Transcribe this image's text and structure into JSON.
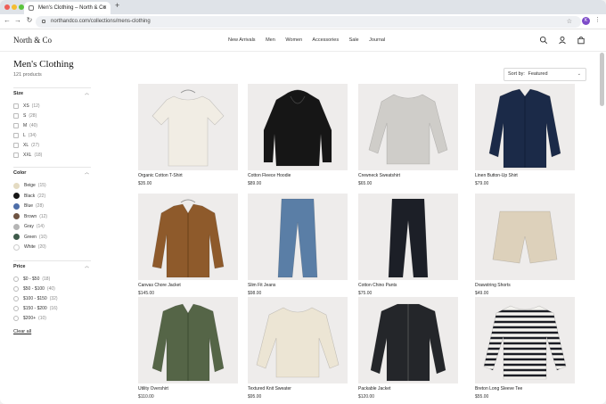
{
  "browser": {
    "tab_title": "Men's Clothing – North & Co",
    "url": "northandco.com/collections/mens-clothing",
    "profile_initial": "K"
  },
  "site": {
    "logo": "North & Co",
    "nav": [
      "New Arrivals",
      "Men",
      "Women",
      "Accessories",
      "Sale",
      "Journal"
    ]
  },
  "page": {
    "title": "Men's Clothing",
    "count": "121 products",
    "sort_label": "Sort by:",
    "sort_value": "Featured"
  },
  "filters": {
    "size": {
      "title": "Size",
      "options": [
        {
          "label": "XS",
          "count": "(12)"
        },
        {
          "label": "S",
          "count": "(28)"
        },
        {
          "label": "M",
          "count": "(40)"
        },
        {
          "label": "L",
          "count": "(34)"
        },
        {
          "label": "XL",
          "count": "(27)"
        },
        {
          "label": "XXL",
          "count": "(18)"
        }
      ]
    },
    "color": {
      "title": "Color",
      "options": [
        {
          "label": "Beige",
          "count": "(15)",
          "hex": "#e4dbc2"
        },
        {
          "label": "Black",
          "count": "(22)",
          "hex": "#161616"
        },
        {
          "label": "Blue",
          "count": "(28)",
          "hex": "#4e6ea8"
        },
        {
          "label": "Brown",
          "count": "(12)",
          "hex": "#6f5443"
        },
        {
          "label": "Gray",
          "count": "(14)",
          "hex": "#b5b5b5"
        },
        {
          "label": "Green",
          "count": "(10)",
          "hex": "#3e5a4a"
        },
        {
          "label": "White",
          "count": "(20)",
          "hex": "#ffffff"
        }
      ]
    },
    "price": {
      "title": "Price",
      "options": [
        {
          "label": "$0 - $50",
          "count": "(18)"
        },
        {
          "label": "$50 - $100",
          "count": "(40)"
        },
        {
          "label": "$100 - $150",
          "count": "(32)"
        },
        {
          "label": "$150 - $200",
          "count": "(16)"
        },
        {
          "label": "$200+",
          "count": "(10)"
        }
      ]
    },
    "clear_all": "Clear all"
  },
  "products": [
    {
      "name": "Organic Cotton T-Shirt",
      "price": "$35.00",
      "icon": "tshirt-image",
      "color": "#f1ede4"
    },
    {
      "name": "Cotton Fleece Hoodie",
      "price": "$89.00",
      "icon": "hoodie-image",
      "color": "#161616"
    },
    {
      "name": "Crewneck Sweatshirt",
      "price": "$65.00",
      "icon": "sweatshirt-image",
      "color": "#cfcdc9"
    },
    {
      "name": "Linen Button-Up Shirt",
      "price": "$79.00",
      "icon": "shirt-image",
      "color": "#1b2a48"
    },
    {
      "name": "Canvas Chore Jacket",
      "price": "$145.00",
      "icon": "jacket-image",
      "color": "#8e5a2b"
    },
    {
      "name": "Slim Fit Jeans",
      "price": "$98.00",
      "icon": "jeans-image",
      "color": "#5a7ea6"
    },
    {
      "name": "Cotton Chino Pants",
      "price": "$75.00",
      "icon": "pants-image",
      "color": "#1c1f27"
    },
    {
      "name": "Drawstring Shorts",
      "price": "$49.00",
      "icon": "shorts-image",
      "color": "#ddd1bb"
    },
    {
      "name": "Utility Overshirt",
      "price": "$110.00",
      "icon": "overshirt-image",
      "color": "#556547"
    },
    {
      "name": "Textured Knit Sweater",
      "price": "$95.00",
      "icon": "sweater-image",
      "color": "#ece5d4"
    },
    {
      "name": "Packable Jacket",
      "price": "$120.00",
      "icon": "packable-jacket-image",
      "color": "#24262a"
    },
    {
      "name": "Breton Long Sleeve Tee",
      "price": "$55.00",
      "icon": "breton-tee-image",
      "color": "#f4f3ef"
    }
  ]
}
